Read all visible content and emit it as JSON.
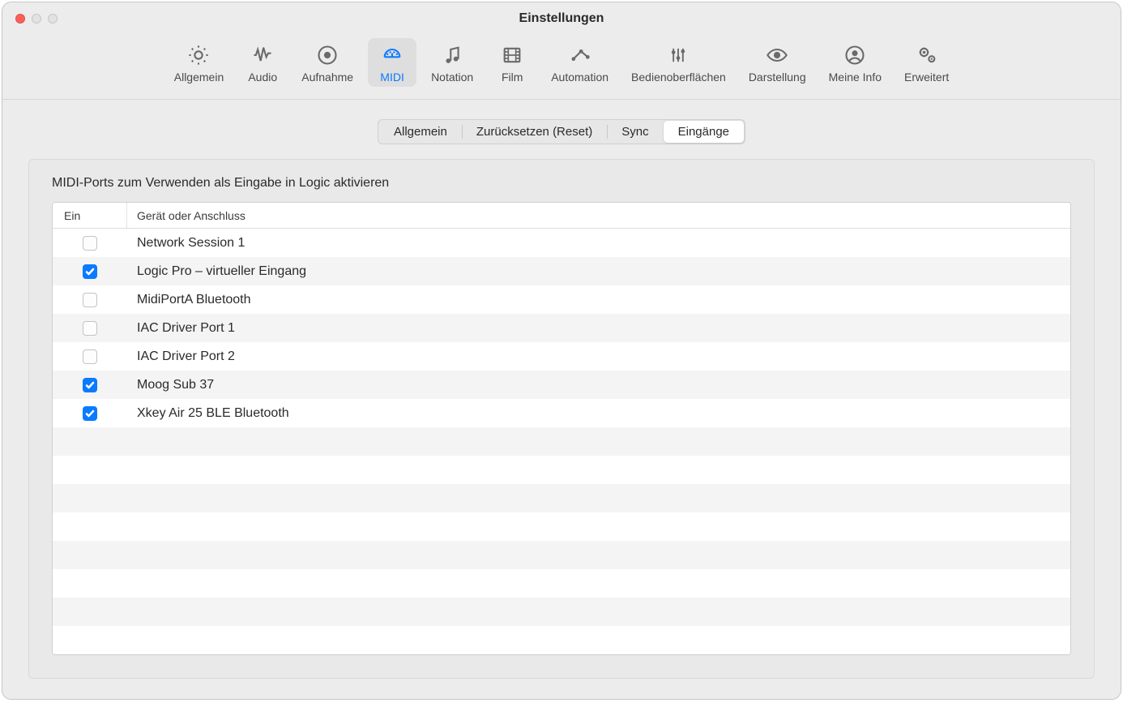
{
  "window": {
    "title": "Einstellungen"
  },
  "toolbar": {
    "active_index": 3,
    "items": [
      {
        "id": "general",
        "label": "Allgemein"
      },
      {
        "id": "audio",
        "label": "Audio"
      },
      {
        "id": "recording",
        "label": "Aufnahme"
      },
      {
        "id": "midi",
        "label": "MIDI"
      },
      {
        "id": "notation",
        "label": "Notation"
      },
      {
        "id": "film",
        "label": "Film"
      },
      {
        "id": "automation",
        "label": "Automation"
      },
      {
        "id": "surfaces",
        "label": "Bedienoberflächen"
      },
      {
        "id": "display",
        "label": "Darstellung"
      },
      {
        "id": "myinfo",
        "label": "Meine Info"
      },
      {
        "id": "advanced",
        "label": "Erweitert"
      }
    ]
  },
  "subtabs": {
    "active_index": 3,
    "items": [
      {
        "id": "general",
        "label": "Allgemein"
      },
      {
        "id": "reset",
        "label": "Zurücksetzen (Reset)"
      },
      {
        "id": "sync",
        "label": "Sync"
      },
      {
        "id": "inputs",
        "label": "Eingänge"
      }
    ]
  },
  "panel": {
    "heading": "MIDI-Ports zum Verwenden als Eingabe in Logic aktivieren",
    "columns": {
      "ein": "Ein",
      "device": "Gerät oder Anschluss"
    },
    "rows": [
      {
        "enabled": false,
        "device": "Network Session 1"
      },
      {
        "enabled": true,
        "device": "Logic Pro – virtueller Eingang"
      },
      {
        "enabled": false,
        "device": "MidiPortA Bluetooth"
      },
      {
        "enabled": false,
        "device": "IAC Driver Port 1"
      },
      {
        "enabled": false,
        "device": "IAC Driver Port 2"
      },
      {
        "enabled": true,
        "device": "Moog Sub 37"
      },
      {
        "enabled": true,
        "device": "Xkey Air 25 BLE Bluetooth"
      }
    ],
    "empty_rows": 8
  }
}
